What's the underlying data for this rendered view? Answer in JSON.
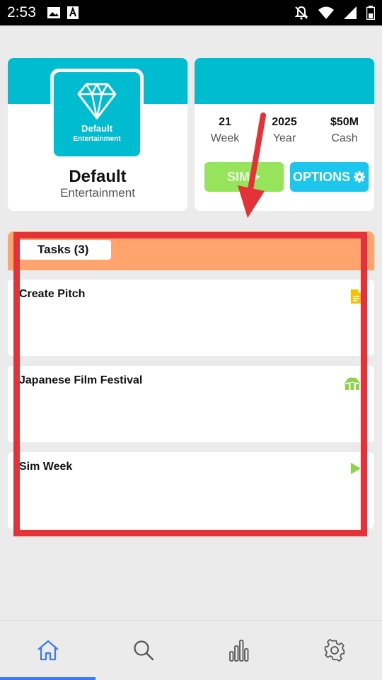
{
  "status_bar": {
    "time": "2:53"
  },
  "studio": {
    "logo_name": "Default",
    "logo_sub": "Entertainment",
    "name": "Default",
    "subtitle": "Entertainment"
  },
  "stats": {
    "week_value": "21",
    "week_label": "Week",
    "year_value": "2025",
    "year_label": "Year",
    "cash_value": "$50M",
    "cash_label": "Cash"
  },
  "buttons": {
    "sim_label": "SIM",
    "options_label": "OPTIONS"
  },
  "tasks": {
    "tab_label": "Tasks (3)",
    "items": [
      {
        "title": "Create Pitch",
        "icon": "document-icon",
        "icon_color": "#f4c20d"
      },
      {
        "title": "Japanese Film Festival",
        "icon": "pavilion-icon",
        "icon_color": "#8bd449"
      },
      {
        "title": "Sim Week",
        "icon": "play-icon",
        "icon_color": "#8bd449"
      }
    ]
  },
  "colors": {
    "teal": "#00bcd0",
    "orange": "#ffa46c",
    "green": "#96e35c",
    "blue": "#1cc6ec",
    "annotation_red": "#e53238",
    "nav_active": "#3a7bf2"
  },
  "bottom_nav": [
    "home-icon",
    "search-icon",
    "stats-icon",
    "settings-icon"
  ]
}
